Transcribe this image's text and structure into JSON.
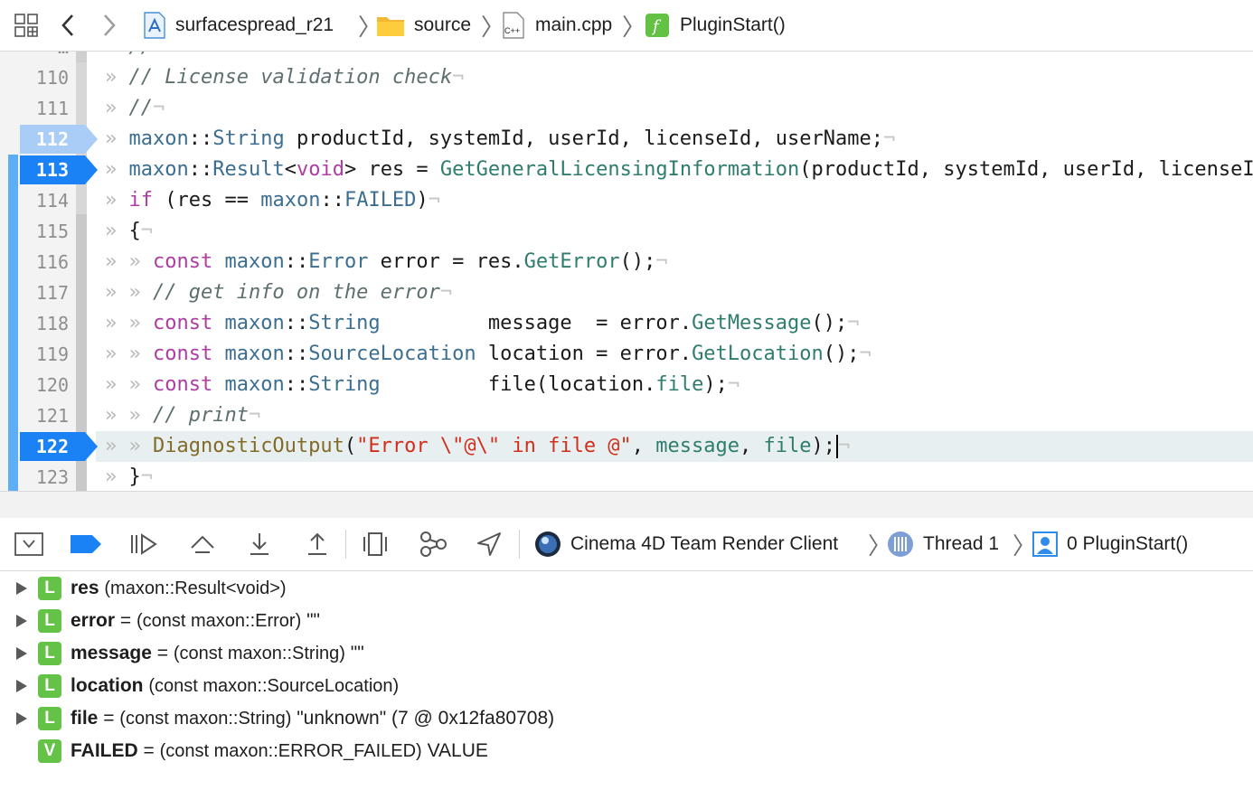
{
  "jumpbar": {
    "project": "surfacespread_r21",
    "folder": "source",
    "file": "main.cpp",
    "function": "PluginStart()"
  },
  "editor": {
    "lines": [
      {
        "num": "110",
        "bp": false,
        "current": false
      },
      {
        "num": "111",
        "bp": false,
        "current": false
      },
      {
        "num": "112",
        "bp": true,
        "bp_disabled": true,
        "current": false
      },
      {
        "num": "113",
        "bp": true,
        "bp_disabled": false,
        "current": false
      },
      {
        "num": "114",
        "bp": false,
        "current": false
      },
      {
        "num": "115",
        "bp": false,
        "current": false
      },
      {
        "num": "116",
        "bp": false,
        "current": false
      },
      {
        "num": "117",
        "bp": false,
        "current": false
      },
      {
        "num": "118",
        "bp": false,
        "current": false
      },
      {
        "num": "119",
        "bp": false,
        "current": false
      },
      {
        "num": "120",
        "bp": false,
        "current": false
      },
      {
        "num": "121",
        "bp": false,
        "current": false
      },
      {
        "num": "122",
        "bp": true,
        "bp_disabled": false,
        "current": true
      },
      {
        "num": "123",
        "bp": false,
        "current": false
      }
    ],
    "tokens": {
      "c110": "// License validation check",
      "c111": "//",
      "t_maxon": "maxon",
      "t_sep": "::",
      "t_String": "String",
      "t_Result": "Result",
      "t_void": "void",
      "t_Error": "Error",
      "t_SourceLocation": "SourceLocation",
      "t_FAILED": "FAILED",
      "kw_if": "if",
      "kw_const": "const",
      "l112_rest": " productId, systemId, userId, licenseId, userName;",
      "l113_lt": "<",
      "l113_gt": "> res = ",
      "l113_fn": "GetGeneralLicensingInformation",
      "l113_rest": "(productId, systemId, userId, licenseId, userName);",
      "l114_a": " (res == ",
      "l114_b": ")",
      "l115": "{",
      "l116_a": " error = res.",
      "l116_fn": "GetError",
      "l116_b": "();",
      "c117": "// get info on the error",
      "l118_pad": "         ",
      "l118_a": "message  = error.",
      "l118_fn": "GetMessage",
      "l118_b": "();",
      "l119_a": " location = error.",
      "l119_fn": "GetLocation",
      "l119_b": "();",
      "l120_pad": "         ",
      "l120_a": "file(location.",
      "l120_fld": "file",
      "l120_b": ");",
      "c121": "// print",
      "l122_fn": "DiagnosticOutput",
      "l122_a": "(",
      "l122_str": "\"Error \\\"@\\\" in file @\"",
      "l122_b": ", ",
      "l122_m": "message",
      "l122_c": ", ",
      "l122_f": "file",
      "l122_d": ");",
      "l123": "}",
      "ind1": "» ",
      "ind2": "» » ",
      "eol": "¬"
    }
  },
  "debugbar": {
    "process": "Cinema 4D Team Render Client",
    "thread": "Thread 1",
    "frame": "0 PluginStart()"
  },
  "variables": [
    {
      "badge": "L",
      "name": "res",
      "eq": "",
      "type": "(maxon::Result<void>)",
      "value": "",
      "expandable": true
    },
    {
      "badge": "L",
      "name": "error",
      "eq": "=",
      "type": "(const maxon::Error)",
      "value": "\"\"",
      "expandable": true
    },
    {
      "badge": "L",
      "name": "message",
      "eq": "=",
      "type": "(const maxon::String)",
      "value": "\"\"",
      "expandable": true
    },
    {
      "badge": "L",
      "name": "location",
      "eq": "",
      "type": "(const maxon::SourceLocation)",
      "value": "",
      "expandable": true
    },
    {
      "badge": "L",
      "name": "file",
      "eq": "=",
      "type": "(const maxon::String)",
      "value": "\"unknown\" (7 @ 0x12fa80708)",
      "expandable": true
    },
    {
      "badge": "V",
      "name": "FAILED",
      "eq": "=",
      "type": "(const maxon::ERROR_FAILED)",
      "value": "VALUE",
      "expandable": false
    }
  ],
  "colors": {
    "breakpoint": "#1a82f5",
    "breakpoint_disabled": "#a9cdf7",
    "badge_green": "#64c247",
    "current_line": "#e7eff1"
  }
}
